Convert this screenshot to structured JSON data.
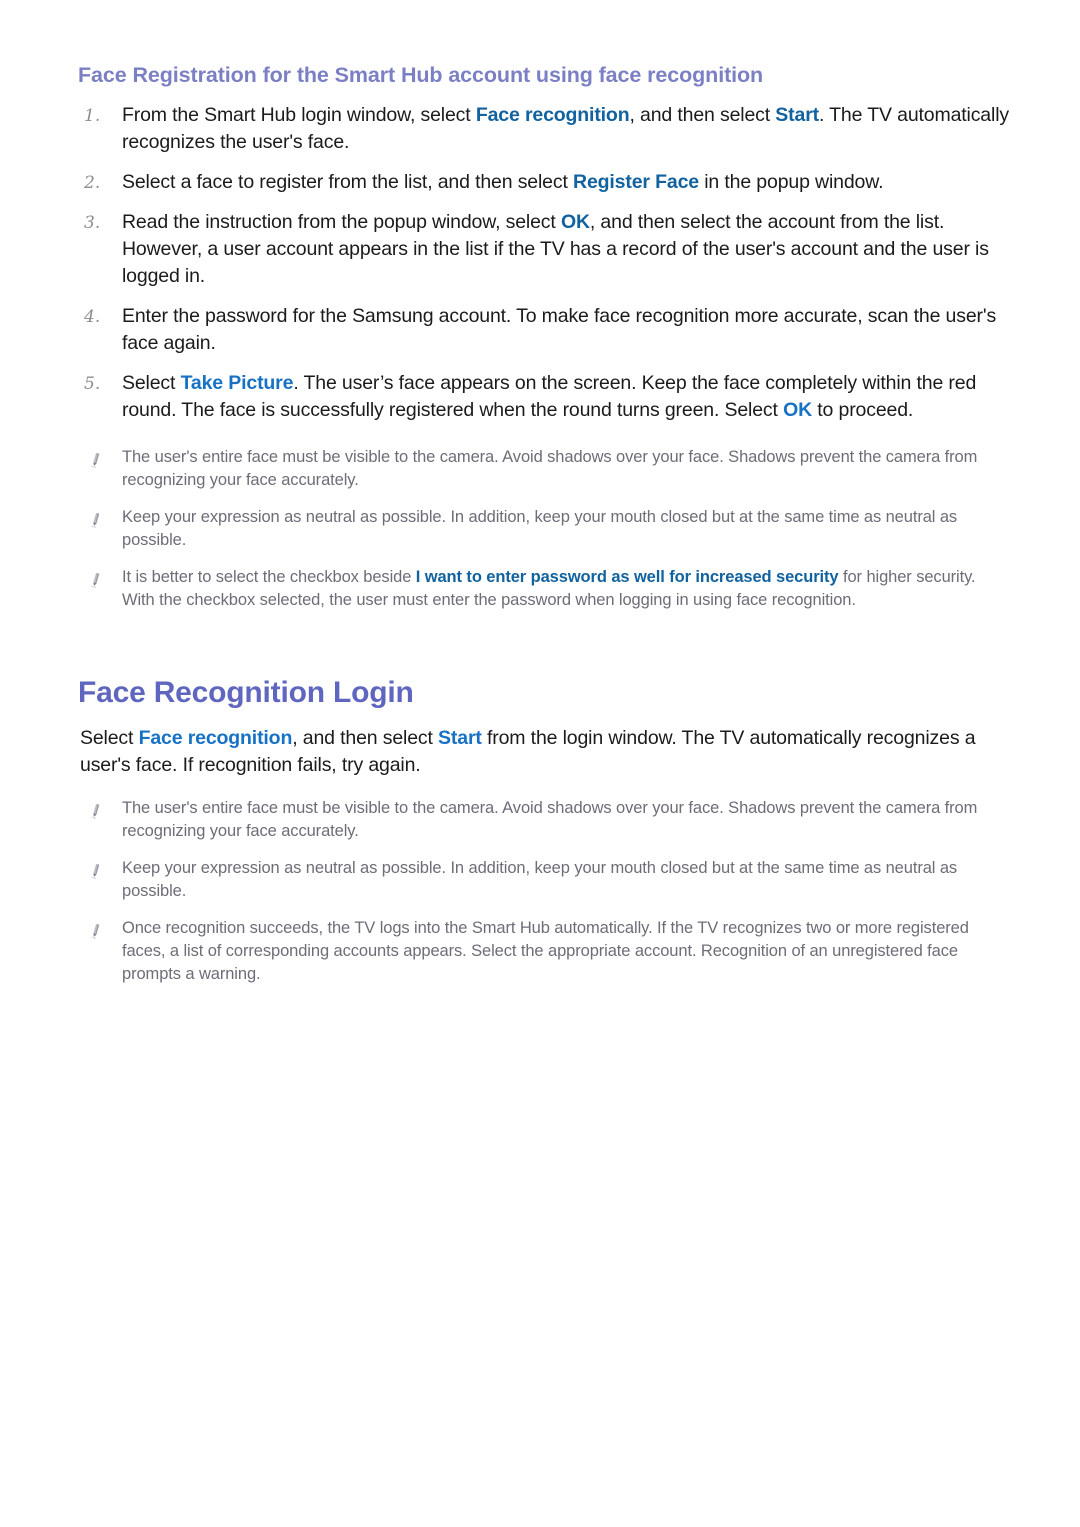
{
  "document": {
    "section_title": "Face Registration for the Smart Hub account using face recognition",
    "page_heading": "Face Recognition Login"
  },
  "colors": {
    "heading_purple": "#5f66bf",
    "section_title_purple": "#7b7fc4",
    "ui_term_blue": "#11629f",
    "ui_term_blue_alt": "#1772c6",
    "body_text": "#1b1b1b",
    "note_text": "#6d6d78",
    "step_number": "#8d8d8d",
    "page_background": "#ffffff"
  },
  "icons": {
    "note_bullet": "pencil-icon"
  },
  "steps": [
    {
      "number": "1.",
      "parts": [
        {
          "t": "From the Smart Hub login window, select ",
          "s": "plain"
        },
        {
          "t": "Face recognition",
          "s": "term"
        },
        {
          "t": ", and then select ",
          "s": "plain"
        },
        {
          "t": "Start",
          "s": "term"
        },
        {
          "t": ". The TV automatically recognizes the user's face.",
          "s": "plain"
        }
      ]
    },
    {
      "number": "2.",
      "parts": [
        {
          "t": "Select a face to register from the list, and then select ",
          "s": "plain"
        },
        {
          "t": "Register Face",
          "s": "term"
        },
        {
          "t": " in the popup window.",
          "s": "plain"
        }
      ]
    },
    {
      "number": "3.",
      "parts": [
        {
          "t": "Read the instruction from the popup window, select ",
          "s": "plain"
        },
        {
          "t": "OK",
          "s": "term"
        },
        {
          "t": ", and then select the account from the list. However, a user account appears in the list if the TV has a record of the user's account and the user is logged in.",
          "s": "plain"
        }
      ]
    },
    {
      "number": "4.",
      "parts": [
        {
          "t": "Enter the password for the Samsung account. To make face recognition more accurate, scan the user's face again.",
          "s": "plain"
        }
      ]
    },
    {
      "number": "5.",
      "parts": [
        {
          "t": "Select ",
          "s": "plain"
        },
        {
          "t": "Take Picture",
          "s": "term-alt"
        },
        {
          "t": ". The user’s face appears on the screen. Keep the face completely within the red round. The face is successfully registered when the round turns green. Select ",
          "s": "plain"
        },
        {
          "t": "OK",
          "s": "term-alt"
        },
        {
          "t": " to proceed.",
          "s": "plain"
        }
      ]
    }
  ],
  "notes_registration": [
    {
      "parts": [
        {
          "t": "The user's entire face must be visible to the camera. Avoid shadows over your face. Shadows prevent the camera from recognizing your face accurately.",
          "s": "plain"
        }
      ]
    },
    {
      "parts": [
        {
          "t": "Keep your expression as neutral as possible. In addition, keep your mouth closed but at the same time as neutral as possible.",
          "s": "plain"
        }
      ]
    },
    {
      "parts": [
        {
          "t": "It is better to select the checkbox beside ",
          "s": "plain"
        },
        {
          "t": "I want to enter password as well for increased security",
          "s": "term"
        },
        {
          "t": " for higher security. With the checkbox selected, the user must enter the password when logging in using face recognition.",
          "s": "plain"
        }
      ]
    }
  ],
  "login_paragraph": {
    "parts": [
      {
        "t": "Select ",
        "s": "plain"
      },
      {
        "t": "Face recognition",
        "s": "term-alt"
      },
      {
        "t": ", and then select ",
        "s": "plain"
      },
      {
        "t": "Start",
        "s": "term-alt"
      },
      {
        "t": " from the login window. The TV automatically recognizes a user's face. If recognition fails, try again.",
        "s": "plain"
      }
    ]
  },
  "notes_login": [
    {
      "parts": [
        {
          "t": "The user's entire face must be visible to the camera. Avoid shadows over your face. Shadows prevent the camera from recognizing your face accurately.",
          "s": "plain"
        }
      ]
    },
    {
      "parts": [
        {
          "t": "Keep your expression as neutral as possible. In addition, keep your mouth closed but at the same time as neutral as possible.",
          "s": "plain"
        }
      ]
    },
    {
      "parts": [
        {
          "t": "Once recognition succeeds, the TV logs into the Smart Hub automatically. If the TV recognizes two or more registered faces, a list of corresponding accounts appears. Select the appropriate account. Recognition of an unregistered face prompts a warning.",
          "s": "plain"
        }
      ]
    }
  ]
}
